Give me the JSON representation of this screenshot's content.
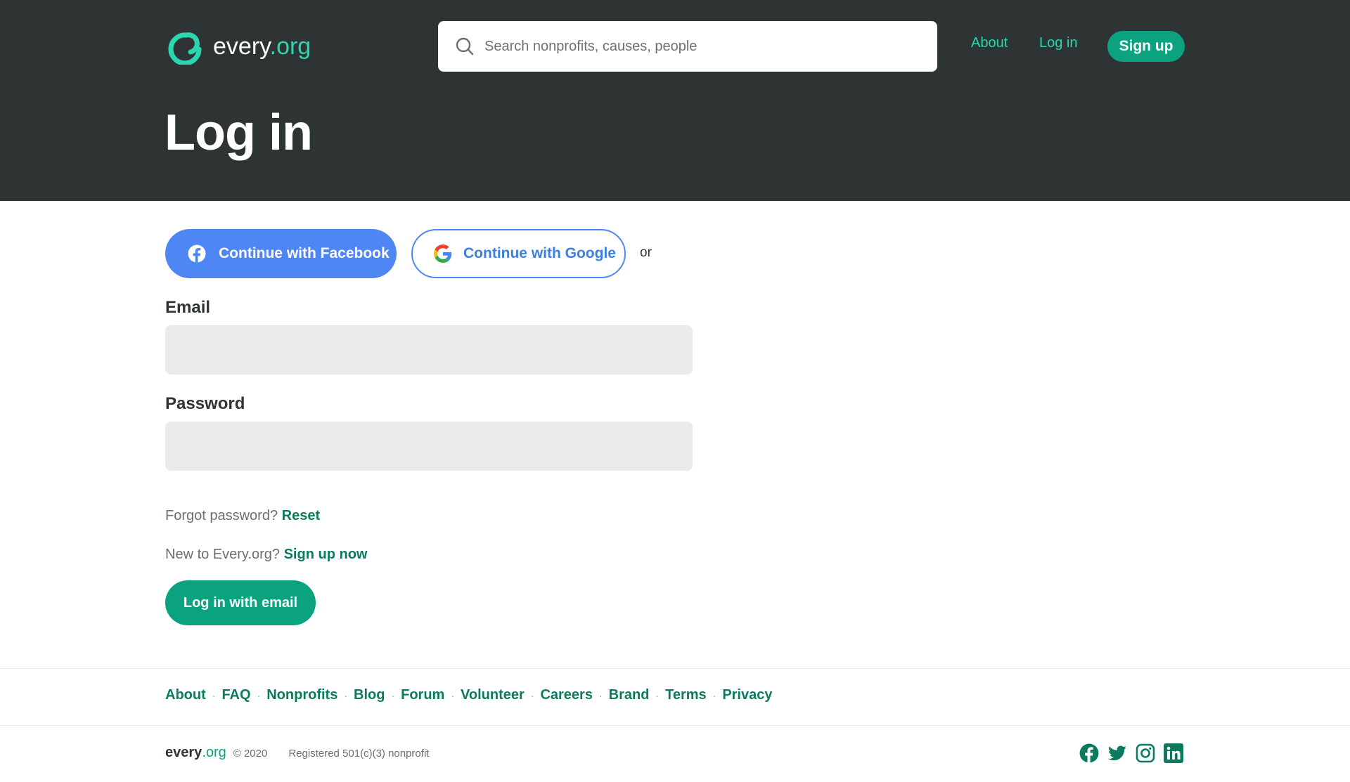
{
  "header": {
    "logo": {
      "name": "every",
      "tld": ".org"
    },
    "search": {
      "placeholder": "Search nonprofits, causes, people"
    },
    "nav": {
      "about": "About",
      "login": "Log in",
      "signup": "Sign up"
    },
    "title": "Log in"
  },
  "auth": {
    "facebook_label": "Continue with Facebook",
    "google_label": "Continue with Google",
    "or": "or",
    "email_label": "Email",
    "email_value": "",
    "password_label": "Password",
    "password_value": "",
    "forgot_text": "Forgot password?",
    "forgot_link": "Reset",
    "new_text": "New to Every.org?",
    "new_link": "Sign up now",
    "submit_label": "Log in with email"
  },
  "footer": {
    "links": [
      "About",
      "FAQ",
      "Nonprofits",
      "Blog",
      "Forum",
      "Volunteer",
      "Careers",
      "Brand",
      "Terms",
      "Privacy"
    ],
    "logo_name": "every",
    "logo_tld": ".org",
    "copyright": "© 2020",
    "registered": "Registered 501(c)(3) nonprofit",
    "social": [
      "facebook-icon",
      "twitter-icon",
      "instagram-icon",
      "linkedin-icon"
    ]
  },
  "colors": {
    "header_bg": "#2e3434",
    "accent": "#2bd7b0",
    "primary": "#0ba37f",
    "link": "#0c7a5f",
    "facebook": "#4e87f4",
    "input_bg": "#eaebeb"
  }
}
